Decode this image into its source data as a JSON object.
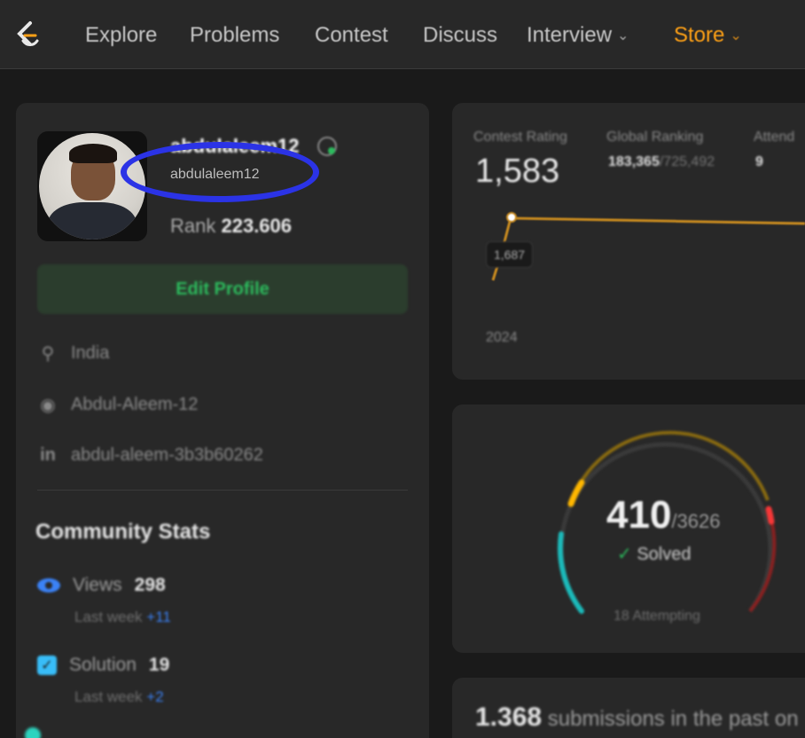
{
  "nav": {
    "items": [
      {
        "label": "Explore"
      },
      {
        "label": "Problems"
      },
      {
        "label": "Contest"
      },
      {
        "label": "Discuss"
      },
      {
        "label": "Interview",
        "has_dropdown": true
      },
      {
        "label": "Store",
        "has_dropdown": true,
        "color": "#ffa116"
      }
    ],
    "logo_icon": "leetcode-logo-icon"
  },
  "profile": {
    "display_name": "abdulaleem12",
    "username": "abdulaleem12",
    "rank_label": "Rank",
    "rank_value": "223.606",
    "edit_label": "Edit Profile",
    "location": "India",
    "github": "Abdul-Aleem-12",
    "linkedin": "abdul-aleem-3b3b60262",
    "avatar_icon": "user-avatar",
    "badge_icon": "badge-icon"
  },
  "community": {
    "title": "Community Stats",
    "views_label": "Views",
    "views_value": "298",
    "views_sub": "Last week",
    "views_delta": "+11",
    "solution_label": "Solution",
    "solution_value": "19",
    "solution_sub": "Last week",
    "solution_delta": "+2"
  },
  "contest": {
    "rating_label": "Contest Rating",
    "rating_value": "1,583",
    "global_label": "Global Ranking",
    "global_rank": "183,365",
    "global_total": "/725,492",
    "attended_label": "Attend",
    "attended_value": "9",
    "tooltip": "1,687",
    "year": "2024",
    "line_color": "#ffa116"
  },
  "solved": {
    "count": "410",
    "total": "/3626",
    "label": "Solved",
    "attempting": "18 Attempting",
    "colors": {
      "easy": "#1cbaba",
      "medium": "#ffb700",
      "hard": "#f63737"
    }
  },
  "submissions": {
    "count": "1.368",
    "text": "submissions in the past on"
  }
}
